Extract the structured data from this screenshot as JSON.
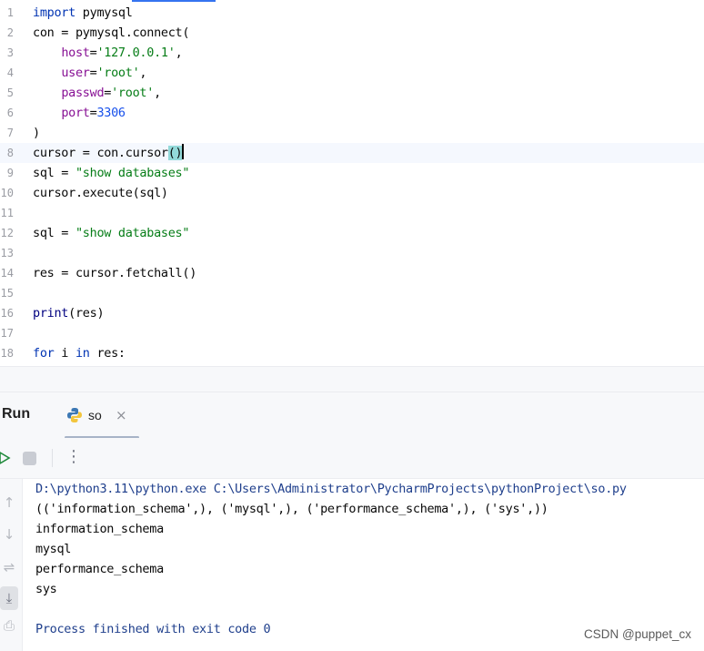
{
  "editor": {
    "lines": [
      {
        "n": "1",
        "segments": [
          {
            "t": "import",
            "c": "kw"
          },
          {
            "t": " pymysql",
            "c": ""
          }
        ]
      },
      {
        "n": "2",
        "segments": [
          {
            "t": "con = pymysql.connect(",
            "c": ""
          }
        ]
      },
      {
        "n": "3",
        "segments": [
          {
            "t": "    ",
            "c": ""
          },
          {
            "t": "host",
            "c": "param"
          },
          {
            "t": "=",
            "c": ""
          },
          {
            "t": "'127.0.0.1'",
            "c": "str"
          },
          {
            "t": ",",
            "c": ""
          }
        ]
      },
      {
        "n": "4",
        "segments": [
          {
            "t": "    ",
            "c": ""
          },
          {
            "t": "user",
            "c": "param"
          },
          {
            "t": "=",
            "c": ""
          },
          {
            "t": "'root'",
            "c": "str"
          },
          {
            "t": ",",
            "c": ""
          }
        ]
      },
      {
        "n": "5",
        "segments": [
          {
            "t": "    ",
            "c": ""
          },
          {
            "t": "passwd",
            "c": "param"
          },
          {
            "t": "=",
            "c": ""
          },
          {
            "t": "'root'",
            "c": "str"
          },
          {
            "t": ",",
            "c": ""
          }
        ]
      },
      {
        "n": "6",
        "segments": [
          {
            "t": "    ",
            "c": ""
          },
          {
            "t": "port",
            "c": "param"
          },
          {
            "t": "=",
            "c": ""
          },
          {
            "t": "3306",
            "c": "num"
          }
        ]
      },
      {
        "n": "7",
        "segments": [
          {
            "t": ")",
            "c": ""
          }
        ]
      },
      {
        "n": "8",
        "segments": [
          {
            "t": "cursor = con.cursor",
            "c": ""
          },
          {
            "t": "()",
            "c": "brk"
          }
        ],
        "current": true
      },
      {
        "n": "9",
        "segments": [
          {
            "t": "sql = ",
            "c": ""
          },
          {
            "t": "\"show databases\"",
            "c": "str"
          }
        ]
      },
      {
        "n": "10",
        "segments": [
          {
            "t": "cursor.execute(sql)",
            "c": ""
          }
        ]
      },
      {
        "n": "11",
        "segments": []
      },
      {
        "n": "12",
        "segments": [
          {
            "t": "sql = ",
            "c": ""
          },
          {
            "t": "\"show databases\"",
            "c": "str"
          }
        ]
      },
      {
        "n": "13",
        "segments": []
      },
      {
        "n": "14",
        "segments": [
          {
            "t": "res = cursor.fetchall()",
            "c": ""
          }
        ]
      },
      {
        "n": "15",
        "segments": []
      },
      {
        "n": "16",
        "segments": [
          {
            "t": "print",
            "c": "fn"
          },
          {
            "t": "(res)",
            "c": ""
          }
        ]
      },
      {
        "n": "17",
        "segments": []
      },
      {
        "n": "18",
        "segments": [
          {
            "t": "for",
            "c": "kw"
          },
          {
            "t": " i ",
            "c": ""
          },
          {
            "t": "in",
            "c": "kw"
          },
          {
            "t": " res:",
            "c": ""
          }
        ]
      }
    ]
  },
  "run_panel": {
    "title": "Run",
    "tab_label": "so",
    "tab_close": "×",
    "kebab": "⋮"
  },
  "console": {
    "lines": [
      {
        "text": "D:\\python3.11\\python.exe C:\\Users\\Administrator\\PycharmProjects\\pythonProject\\so.py",
        "kind": "sys"
      },
      {
        "text": "(('information_schema',), ('mysql',), ('performance_schema',), ('sys',))",
        "kind": "out"
      },
      {
        "text": "information_schema",
        "kind": "out"
      },
      {
        "text": "mysql",
        "kind": "out"
      },
      {
        "text": "performance_schema",
        "kind": "out"
      },
      {
        "text": "sys",
        "kind": "out"
      },
      {
        "text": "",
        "kind": "out"
      },
      {
        "text": "Process finished with exit code 0",
        "kind": "sys"
      }
    ]
  },
  "watermark": "CSDN @puppet_cx",
  "colors": {
    "keyword": "#0033b3",
    "string": "#067d17",
    "param": "#871094",
    "number": "#1750eb",
    "bracket_highlight": "#93d9d9"
  }
}
